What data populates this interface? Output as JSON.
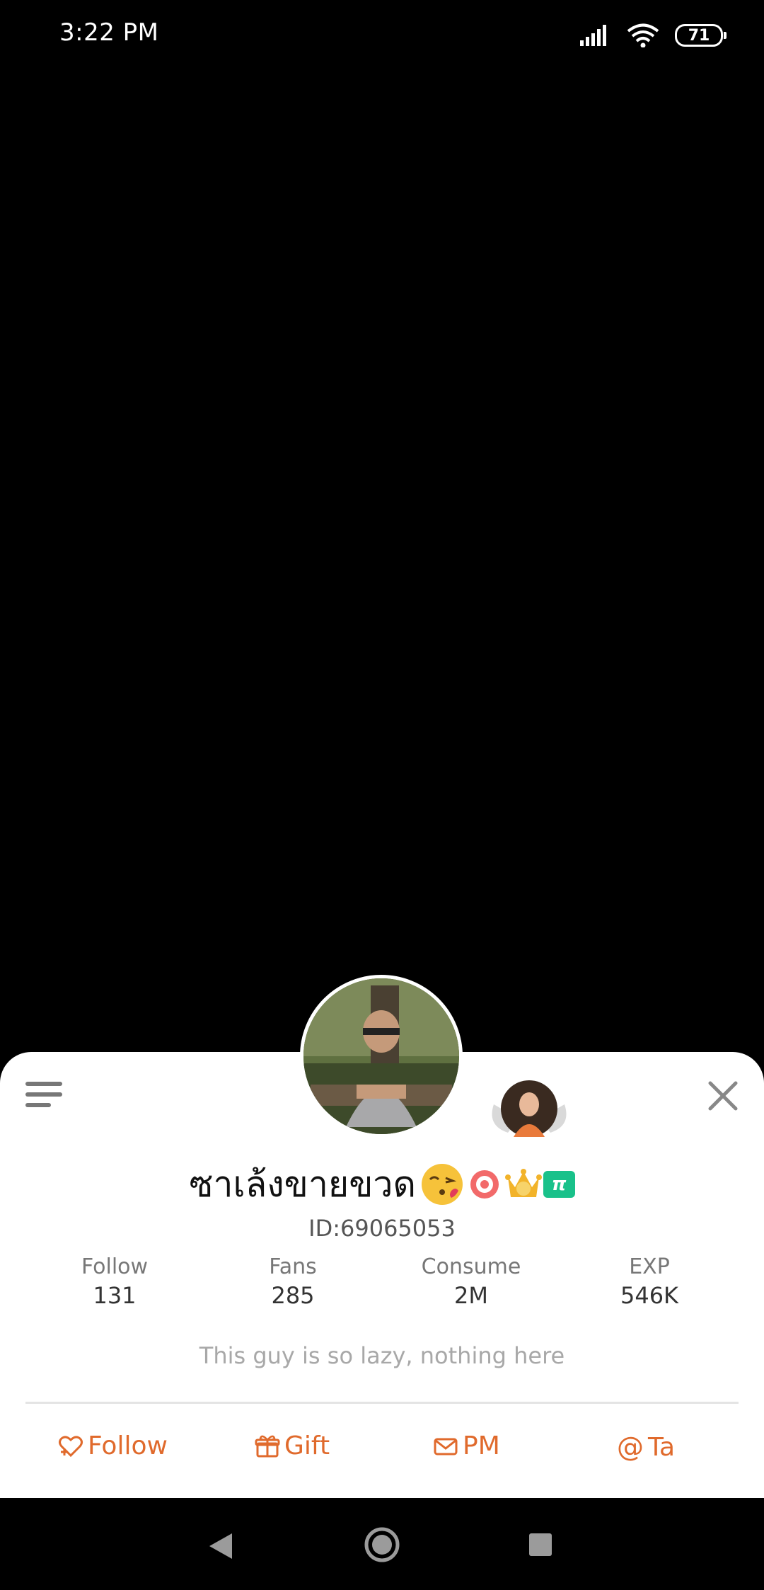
{
  "status_bar": {
    "time": "3:22 PM",
    "battery": "71"
  },
  "profile": {
    "username": "ซาเล้งขายขวด",
    "level_badge": "π",
    "user_id": "ID:69065053",
    "bio": "This guy is so lazy, nothing here",
    "stats": [
      {
        "label": "Follow",
        "value": "131"
      },
      {
        "label": "Fans",
        "value": "285"
      },
      {
        "label": "Consume",
        "value": "2M"
      },
      {
        "label": "EXP",
        "value": "546K"
      }
    ]
  },
  "actions": {
    "follow": "Follow",
    "gift": "Gift",
    "pm": "PM",
    "at": "Ta"
  },
  "colors": {
    "accent": "#e06a2c",
    "sheet_bg": "#ffffff",
    "level_badge": "#19c18a"
  },
  "icons": [
    "menu-icon",
    "close-icon",
    "follow-icon",
    "gift-icon",
    "mail-icon",
    "at-icon",
    "wifi-icon",
    "signal-icon",
    "battery-icon"
  ]
}
